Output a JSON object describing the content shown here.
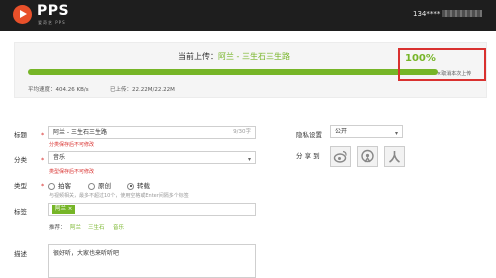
{
  "header": {
    "logo_text": "PPS",
    "logo_sub": "爱奇艺 PPS",
    "username": "134****"
  },
  "upload": {
    "title_prefix": "当前上传：",
    "file_name": "阿兰 - 三生石三生路",
    "progress_percent": 100,
    "progress_label": "100%",
    "cancel_label": "取消本次上传",
    "speed_label": "平均速度：404.26 KB/s",
    "uploaded_label": "已上传：22.22M/22.22M"
  },
  "form": {
    "title_label": "标题",
    "title_value": "阿兰 - 三生石三生路",
    "title_counter": "9/30字",
    "title_note": "分类保存后不可修改",
    "category_label": "分类",
    "category_value": "音乐",
    "category_note": "类型保存后不可修改",
    "type_label": "类型",
    "type_options": [
      "拍客",
      "原创",
      "转载"
    ],
    "type_selected": 2,
    "type_hint": "与视频相关，最多不超过10个，使用空格或Enter间隔多个标签",
    "tags_label": "标签",
    "tag_value": "阿兰",
    "tag_remove": "×",
    "recommend_label": "推荐：",
    "recommend_tags": [
      "阿兰",
      "三生石",
      "音乐"
    ],
    "desc_label": "描述",
    "desc_value": "很好听，大家也来听听吧",
    "required_mark": "*"
  },
  "privacy": {
    "label": "隐私设置",
    "value": "公开",
    "share_label": "分 享 到",
    "share_icons": [
      "weibo-icon",
      "qzone-icon",
      "renren-icon"
    ]
  },
  "colors": {
    "accent_green": "#76b527",
    "required_red": "#d9312f",
    "topbar": "#1e1e1e",
    "logo_orange": "#e8502a"
  }
}
